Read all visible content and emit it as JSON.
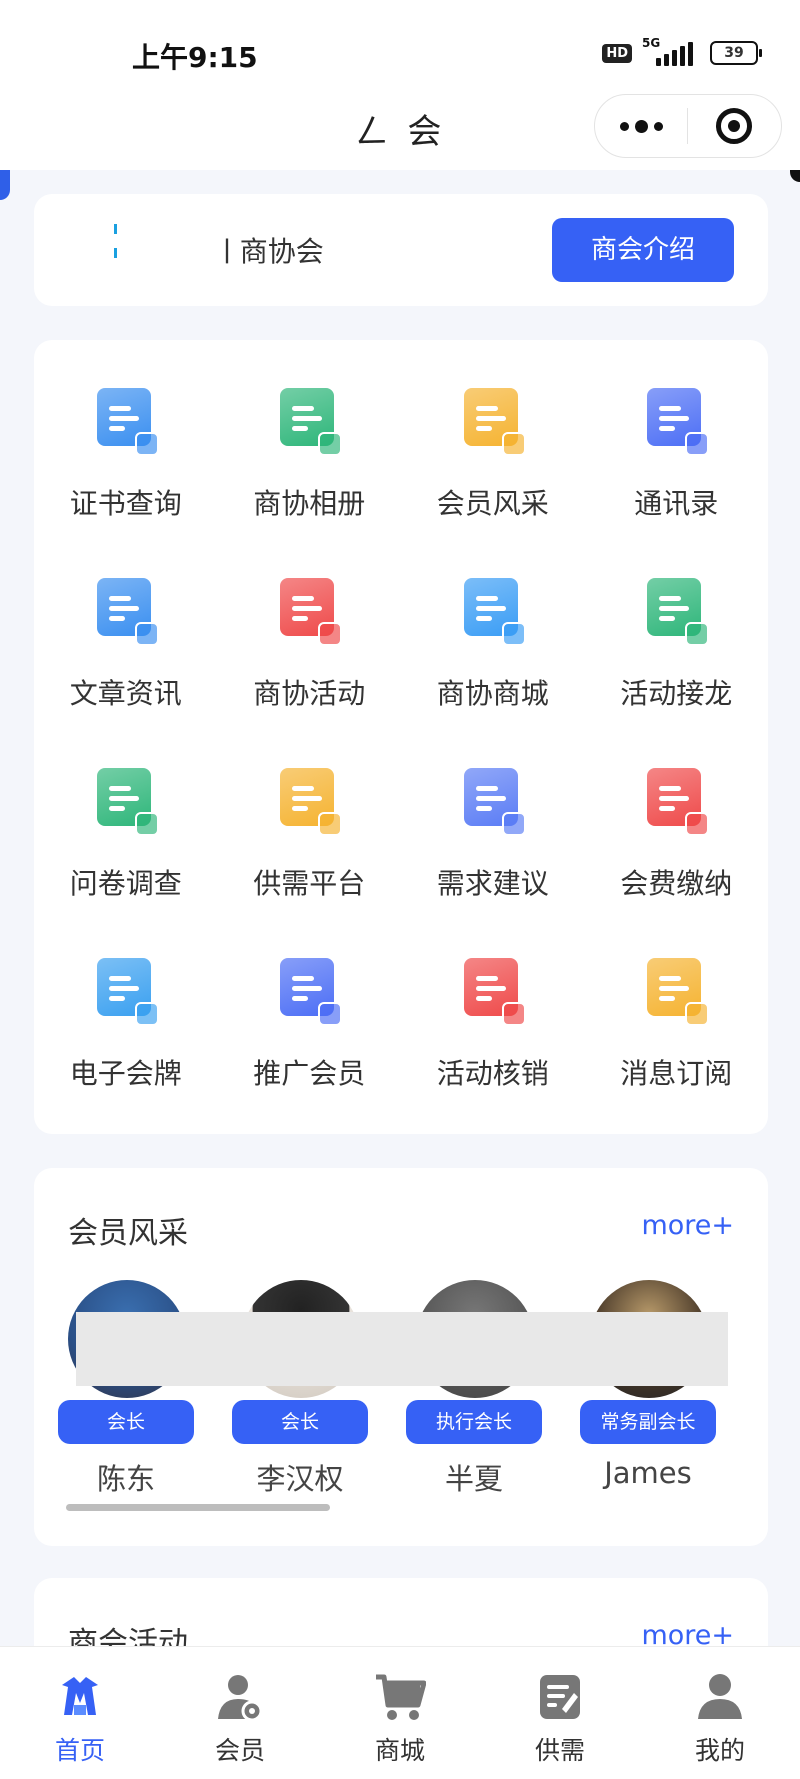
{
  "status_bar": {
    "time": "上午9:15",
    "hd": "HD",
    "network": "5G",
    "battery": "39"
  },
  "nav": {
    "title": "ㄥ      会"
  },
  "header": {
    "org_name": "ㅣ商协会",
    "intro_button": "商会介绍"
  },
  "colors": {
    "accent": "#3661f5",
    "background": "#f4f6fb"
  },
  "grid": [
    {
      "label": "证书查询",
      "icon": "certificate-search-icon",
      "color": "#3a8ff0"
    },
    {
      "label": "商协相册",
      "icon": "photo-album-icon",
      "color": "#2eb67a"
    },
    {
      "label": "会员风采",
      "icon": "members-group-icon",
      "color": "#f5b331"
    },
    {
      "label": "通讯录",
      "icon": "contacts-book-icon",
      "color": "#4c6ef5"
    },
    {
      "label": "文章资讯",
      "icon": "news-article-icon",
      "color": "#3a8ff0"
    },
    {
      "label": "商协活动",
      "icon": "event-flag-icon",
      "color": "#ef4a4a"
    },
    {
      "label": "商协商城",
      "icon": "shopping-bag-icon",
      "color": "#3a9df5"
    },
    {
      "label": "活动接龙",
      "icon": "relay-flag-icon",
      "color": "#2eb67a"
    },
    {
      "label": "问卷调查",
      "icon": "survey-checklist-icon",
      "color": "#2eb67a"
    },
    {
      "label": "供需平台",
      "icon": "supply-demand-heart-icon",
      "color": "#f5b331"
    },
    {
      "label": "需求建议",
      "icon": "suggestion-envelope-icon",
      "color": "#5a7cf5"
    },
    {
      "label": "会费缴纳",
      "icon": "fee-payment-icon",
      "color": "#ef4a4a"
    },
    {
      "label": "电子会牌",
      "icon": "electronic-badge-icon",
      "color": "#3aa0f0"
    },
    {
      "label": "推广会员",
      "icon": "share-promote-icon",
      "color": "#4c6ef5"
    },
    {
      "label": "活动核销",
      "icon": "activity-verify-icon",
      "color": "#ef4a4a"
    },
    {
      "label": "消息订阅",
      "icon": "message-subscribe-icon",
      "color": "#f5b331"
    }
  ],
  "members_section": {
    "title": "会员风采",
    "more": "more+",
    "members": [
      {
        "role": "会长",
        "name": "陈东"
      },
      {
        "role": "会长",
        "name": "李汉权"
      },
      {
        "role": "执行会长",
        "name": "半夏"
      },
      {
        "role": "常务副会长",
        "name": "James"
      }
    ]
  },
  "activity_section": {
    "title": "商会活动",
    "more": "more+"
  },
  "tabbar": [
    {
      "label": "首页",
      "icon": "home-logo-icon",
      "active": true
    },
    {
      "label": "会员",
      "icon": "member-user-icon",
      "active": false
    },
    {
      "label": "商城",
      "icon": "shopping-cart-icon",
      "active": false
    },
    {
      "label": "供需",
      "icon": "supply-document-icon",
      "active": false
    },
    {
      "label": "我的",
      "icon": "profile-person-icon",
      "active": false
    }
  ]
}
